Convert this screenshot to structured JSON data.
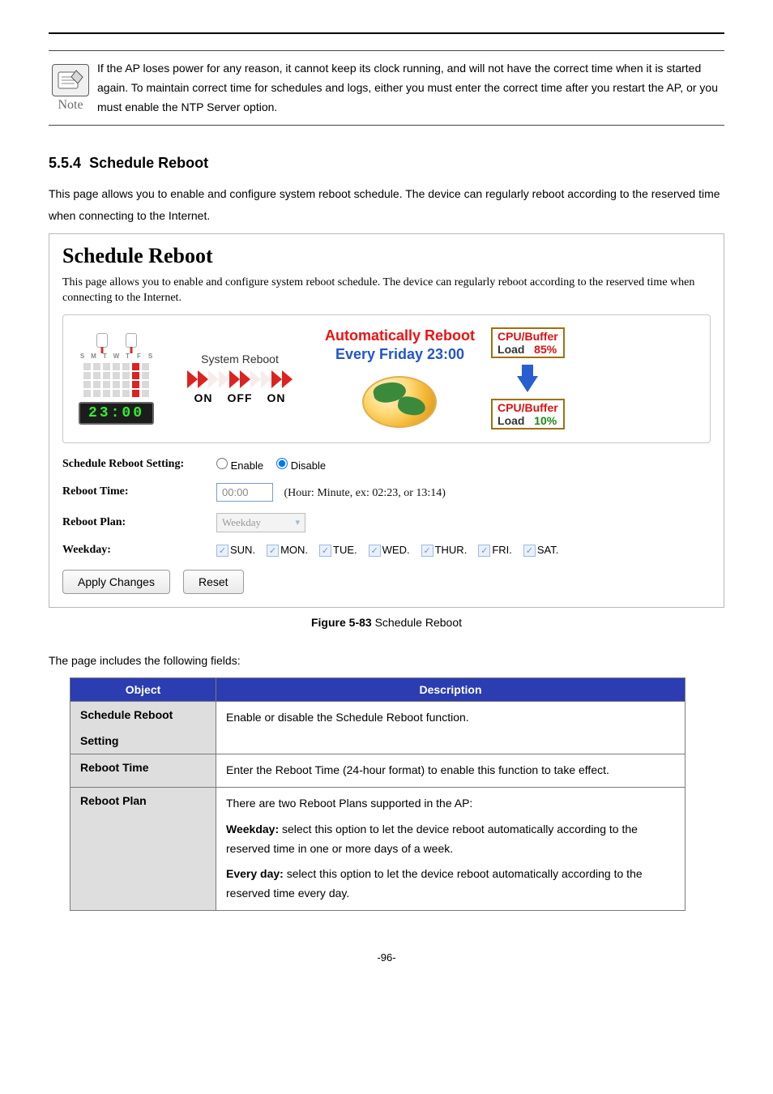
{
  "note": {
    "iconLabel": "Note",
    "text": "If the AP loses power for any reason, it cannot keep its clock running, and will not have the correct time when it is started again. To maintain correct time for schedules and logs, either you must enter the correct time after you restart the AP, or you must enable the NTP Server option."
  },
  "section": {
    "number": "5.5.4",
    "title": "Schedule Reboot"
  },
  "intro": "This page allows you to enable and configure system reboot schedule. The device can regularly reboot according to the reserved time when connecting to the Internet.",
  "panel": {
    "title": "Schedule Reboot",
    "subtext": "This page allows you to enable and configure system reboot schedule. The device can regularly reboot according to the reserved time when connecting to the Internet.",
    "diagram": {
      "dayLetters": [
        "S",
        "M",
        "T",
        "W",
        "T",
        "F",
        "S"
      ],
      "clockTime": "23:00",
      "sysRebootLabel": "System Reboot",
      "onoff": [
        "ON",
        "OFF",
        "ON"
      ],
      "autoLine1": "Automatically Reboot",
      "autoLine2": "Every Friday 23:00",
      "stripeBefore": {
        "label": "CPU/Buffer",
        "load": "Load",
        "pct": "85%"
      },
      "stripeAfter": {
        "label": "CPU/Buffer",
        "load": "Load",
        "pct": "10%"
      }
    },
    "form": {
      "scheduleLabel": "Schedule Reboot Setting:",
      "enable": "Enable",
      "disable": "Disable",
      "selected": "disable",
      "rebootTimeLabel": "Reboot Time:",
      "rebootTimeValue": "00:00",
      "rebootTimeHint": "(Hour: Minute, ex: 02:23, or 13:14)",
      "rebootPlanLabel": "Reboot Plan:",
      "rebootPlanValue": "Weekday",
      "weekdayLabel": "Weekday:",
      "days": [
        "SUN.",
        "MON.",
        "TUE.",
        "WED.",
        "THUR.",
        "FRI.",
        "SAT."
      ]
    },
    "buttons": {
      "apply": "Apply Changes",
      "reset": "Reset"
    }
  },
  "figCaption": {
    "num": "Figure 5-83",
    "text": " Schedule Reboot"
  },
  "afterFig": "The page includes the following fields:",
  "table": {
    "hObject": "Object",
    "hDesc": "Description",
    "rows": [
      {
        "obj1": "Schedule Reboot",
        "obj2": "Setting",
        "desc": "Enable or disable the Schedule Reboot function."
      },
      {
        "obj1": "Reboot Time",
        "desc": "Enter the Reboot Time (24-hour format) to enable this function to take effect."
      },
      {
        "obj1": "Reboot Plan",
        "desc1": "There are two Reboot Plans supported in the AP:",
        "desc2a": "Weekday:",
        "desc2b": " select this option to let the device reboot automatically according to the reserved time in one or more days of a week.",
        "desc3a": "Every day:",
        "desc3b": " select this option to let the device reboot automatically according to the reserved time every day."
      }
    ]
  },
  "pageNum": "-96-"
}
